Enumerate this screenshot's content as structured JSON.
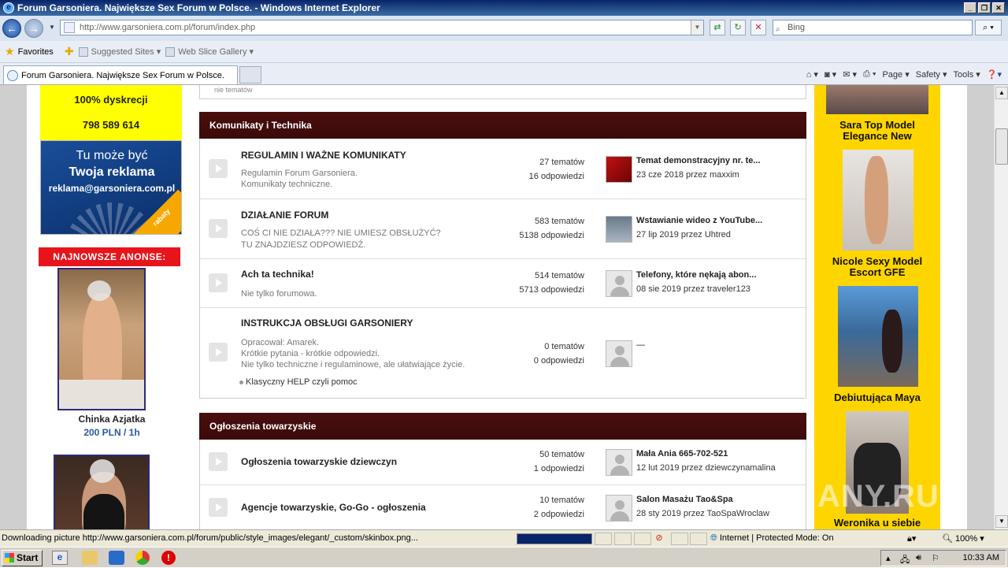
{
  "window": {
    "title": "Forum Garsoniera. Największe Sex Forum w Polsce. - Windows Internet Explorer"
  },
  "address_bar": {
    "url_host": "http://www.garsoniera.com.pl",
    "url_path": "/forum/index.php"
  },
  "search": {
    "placeholder": "Bing"
  },
  "favorites_bar": {
    "favorites_label": "Favorites",
    "items": [
      "Suggested Sites ▾",
      "Web Slice Gallery ▾"
    ]
  },
  "tabs": [
    {
      "label": "Forum Garsoniera. Największe Sex Forum w Polsce."
    }
  ],
  "command_bar": {
    "page": "Page ▾",
    "safety": "Safety ▾",
    "tools": "Tools ▾"
  },
  "left_sidebar": {
    "discretion": "100% dyskrecji",
    "phone": "798 589 614",
    "ad_line1": "Tu może być",
    "ad_line2": "Twoja reklama",
    "ad_email": "reklama@garsoniera.com.pl",
    "ad_corner": "rabaty",
    "newest_header": "NAJNOWSZE ANONSE:",
    "ads": [
      {
        "name": "Chinka Azjatka",
        "price": "200 PLN / 1h"
      }
    ]
  },
  "forum": {
    "prev_fragment": "nie tematów",
    "categories": [
      {
        "title": "Komunikaty i Technika",
        "forums": [
          {
            "title": "REGULAMIN I WAŻNE KOMUNIKATY",
            "desc1": "Regulamin Forum Garsoniera.",
            "desc2": "Komunikaty techniczne.",
            "topics": "27 tematów",
            "replies": "16 odpowiedzi",
            "last_title": "Temat demonstracyjny nr. te...",
            "last_meta": "23 cze 2018 przez maxxim"
          },
          {
            "title": "DZIAŁANIE FORUM",
            "desc1": "COŚ CI NIE DZIAŁA??? NIE UMIESZ OBSŁUŻYĆ?",
            "desc2": "TU ZNAJDZIESZ ODPOWIEDŹ.",
            "topics": "583 tematów",
            "replies": "5138 odpowiedzi",
            "last_title": "Wstawianie wideo z YouTube...",
            "last_meta": "27 lip 2019 przez Uhtred"
          },
          {
            "title": "Ach ta technika!",
            "desc1": "Nie tylko forumowa.",
            "topics": "514 tematów",
            "replies": "5713 odpowiedzi",
            "last_title": "Telefony, które nękają abon...",
            "last_meta": "08 sie 2019 przez traveler123"
          },
          {
            "title": "INSTRUKCJA OBSŁUGI GARSONIERY",
            "desc1": "Opracował: Amarek.",
            "desc2": "Krótkie pytania - krótkie odpowiedzi.",
            "desc3": "Nie tylko techniczne i regulaminowe, ale ułatwiające życie.",
            "subforum": "Klasyczny HELP czyli pomoc",
            "topics": "0 tematów",
            "replies": "0 odpowiedzi",
            "last_title": "—"
          }
        ]
      },
      {
        "title": "Ogłoszenia towarzyskie",
        "forums": [
          {
            "title": "Ogłoszenia towarzyskie dziewczyn",
            "topics": "50 tematów",
            "replies": "1 odpowiedzi",
            "last_title": "Mała Ania 665-702-521",
            "last_meta": "12 lut 2019 przez dziewczynamalina"
          },
          {
            "title": "Agencje towarzyskie, Go-Go - ogłoszenia",
            "topics": "10 tematów",
            "replies": "2 odpowiedzi",
            "last_title": "Salon Masażu Tao&Spa",
            "last_meta": "28 sty 2019 przez TaoSpaWroclaw"
          }
        ]
      }
    ]
  },
  "right_sidebar": {
    "ads": [
      {
        "name_line1": "Sara Top Model",
        "name_line2": "Elegance New"
      },
      {
        "name_line1": "Nicole Sexy Model",
        "name_line2": "Escort GFE"
      },
      {
        "name_line1": "Debiutująca Maya"
      },
      {
        "name_line1": "Weronika u siebie"
      }
    ],
    "watermark": "ANY.RUN"
  },
  "status_bar": {
    "message": "Downloading picture http://www.garsoniera.com.pl/forum/public/style_images/elegant/_custom/skinbox.png...",
    "progress": 1.0,
    "zone": "Internet | Protected Mode: On",
    "zoom": "100%"
  },
  "taskbar": {
    "start_label": "Start",
    "clock": "10:33 AM"
  },
  "colors": {
    "category_header": "#3b0a0a",
    "ad_yellow": "#ffd500",
    "new_header_red": "#e8141b",
    "price_blue": "#2a5a9a"
  }
}
